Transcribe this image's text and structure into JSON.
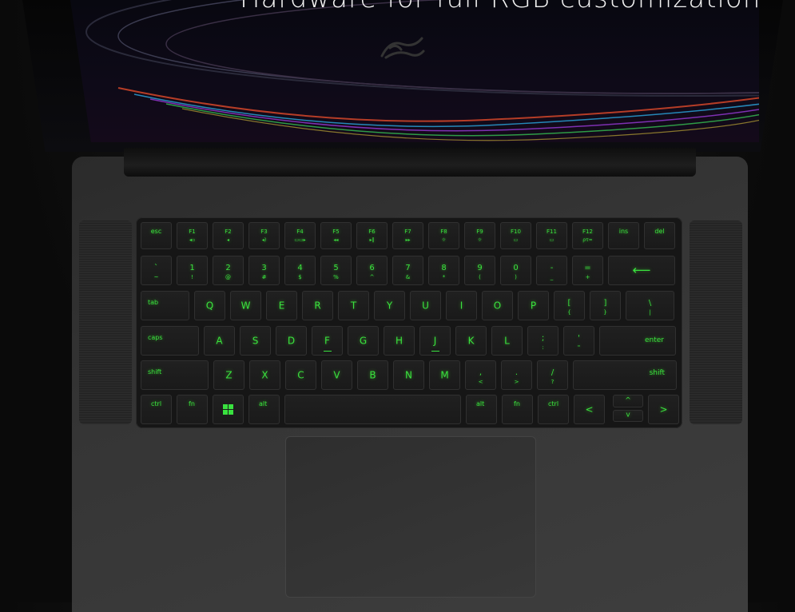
{
  "headline": "Hardware for full RGB customization",
  "accent_color": "#39e23f",
  "logo_icon": "razer-snake-icon",
  "keyboard": {
    "function_row": [
      {
        "label": "esc"
      },
      {
        "label": "F1",
        "sub": "◂▫"
      },
      {
        "label": "F2",
        "sub": "◂"
      },
      {
        "label": "F3",
        "sub": "◂)"
      },
      {
        "label": "F4",
        "sub": "▭▭▸"
      },
      {
        "label": "F5",
        "sub": "◂◂"
      },
      {
        "label": "F6",
        "sub": "▸‖"
      },
      {
        "label": "F7",
        "sub": "▸▸"
      },
      {
        "label": "F8",
        "sub": "☼"
      },
      {
        "label": "F9",
        "sub": "☼"
      },
      {
        "label": "F10",
        "sub": "▭"
      },
      {
        "label": "F11",
        "sub": "▭"
      },
      {
        "label": "F12",
        "sub": "ρτ≈"
      },
      {
        "label": "ins"
      },
      {
        "label": "del"
      }
    ],
    "number_row": [
      {
        "top": "`",
        "bot": "~"
      },
      {
        "top": "1",
        "bot": "!"
      },
      {
        "top": "2",
        "bot": "@"
      },
      {
        "top": "3",
        "bot": "#"
      },
      {
        "top": "4",
        "bot": "$"
      },
      {
        "top": "5",
        "bot": "%"
      },
      {
        "top": "6",
        "bot": "^"
      },
      {
        "top": "7",
        "bot": "&"
      },
      {
        "top": "8",
        "bot": "*"
      },
      {
        "top": "9",
        "bot": "("
      },
      {
        "top": "0",
        "bot": ")"
      },
      {
        "top": "-",
        "bot": "_"
      },
      {
        "top": "=",
        "bot": "+"
      }
    ],
    "backspace": "⟵",
    "tab": "tab",
    "qwerty": [
      "Q",
      "W",
      "E",
      "R",
      "T",
      "Y",
      "U",
      "I",
      "O",
      "P"
    ],
    "brackets": [
      {
        "top": "[",
        "bot": "{"
      },
      {
        "top": "]",
        "bot": "}"
      },
      {
        "top": "\\",
        "bot": "|"
      }
    ],
    "caps": "caps",
    "asdf": [
      "A",
      "S",
      "D",
      "F",
      "G",
      "H",
      "J",
      "K",
      "L"
    ],
    "semicolon": {
      "top": ";",
      "bot": ":"
    },
    "quote": {
      "top": "'",
      "bot": "\""
    },
    "enter": "enter",
    "shift_left": "shift",
    "zxcv": [
      "Z",
      "X",
      "C",
      "V",
      "B",
      "N",
      "M"
    ],
    "comma": {
      "top": ",",
      "bot": "<"
    },
    "period": {
      "top": ".",
      "bot": ">"
    },
    "slash": {
      "top": "/",
      "bot": "?"
    },
    "shift_right": "shift",
    "ctrl_left": "ctrl",
    "fn_left": "fn",
    "windows_icon": "windows-logo-icon",
    "alt_left": "alt",
    "alt_right": "alt",
    "fn_right": "fn",
    "ctrl_right": "ctrl",
    "arrow_left": "<",
    "arrow_up": "^",
    "arrow_down": "v",
    "arrow_right": ">"
  }
}
